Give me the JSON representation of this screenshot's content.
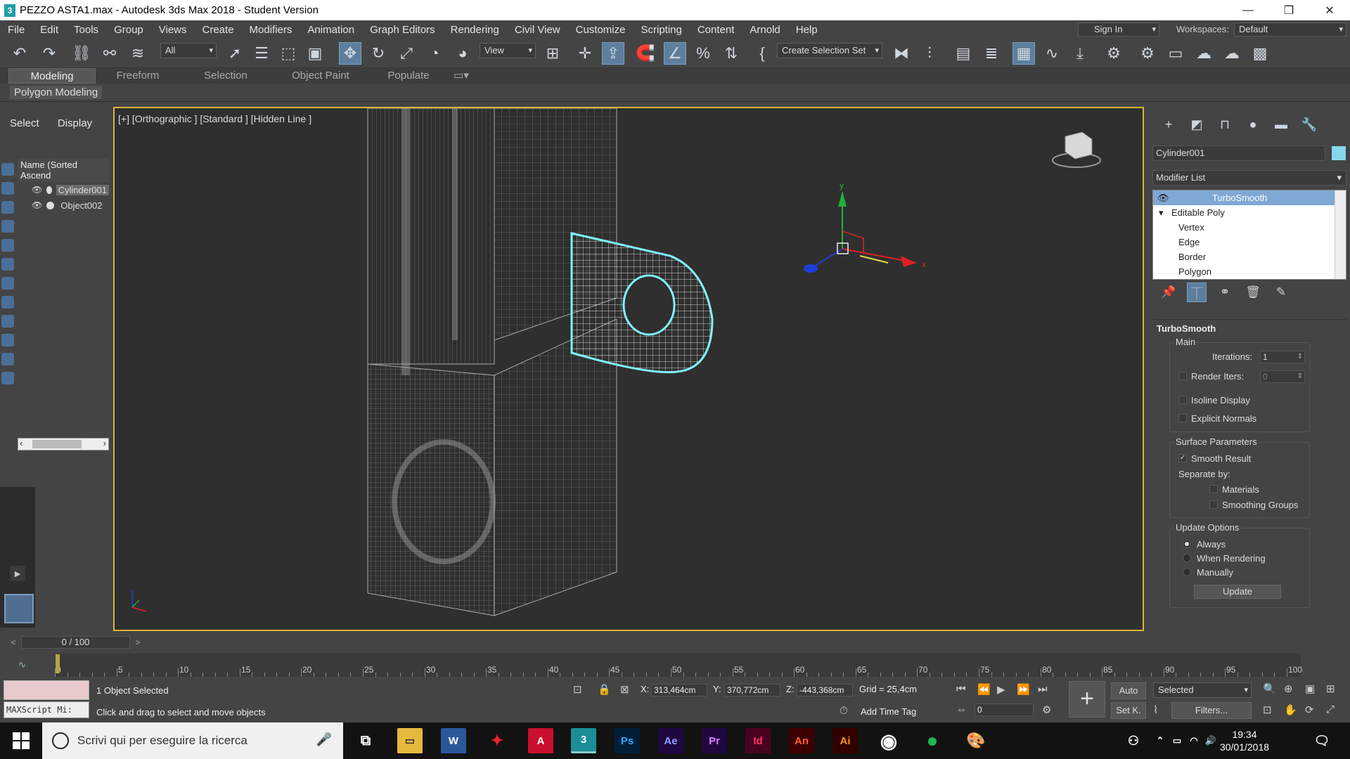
{
  "window": {
    "title": "PEZZO ASTA1.max - Autodesk 3ds Max 2018 - Student Version",
    "icon_label": "3",
    "controls": [
      "—",
      "❐",
      "✕"
    ]
  },
  "menubar": {
    "items": [
      "File",
      "Edit",
      "Tools",
      "Group",
      "Views",
      "Create",
      "Modifiers",
      "Animation",
      "Graph Editors",
      "Rendering",
      "Civil View",
      "Customize",
      "Scripting",
      "Content",
      "Arnold",
      "Help"
    ],
    "sign_in": "Sign In",
    "workspaces_label": "Workspaces:",
    "workspace_value": "Default"
  },
  "toolbar": {
    "selection_filter": "All",
    "ref_coord": "View",
    "create_selection_set": "Create Selection Set"
  },
  "ribbon": {
    "tabs": [
      "Modeling",
      "Freeform",
      "Selection",
      "Object Paint",
      "Populate"
    ],
    "sub": "Polygon Modeling"
  },
  "scene_explorer": {
    "tabs": [
      "Select",
      "Display"
    ],
    "header": "Name (Sorted Ascend",
    "objects": [
      "Cylinder001",
      "Object002"
    ]
  },
  "viewport": {
    "label": "[+] [Orthographic ] [Standard ] [Hidden Line ]",
    "axis_x": "x",
    "axis_y": "y"
  },
  "command_panel": {
    "object_name": "Cylinder001",
    "object_color": "#85d7f0",
    "modifier_list": "Modifier List",
    "stack": [
      "TurboSmooth",
      "Editable Poly",
      "Vertex",
      "Edge",
      "Border",
      "Polygon"
    ],
    "rollout_title": "TurboSmooth",
    "main_group": "Main",
    "iterations_label": "Iterations:",
    "iterations_value": "1",
    "render_iters_label": "Render Iters:",
    "render_iters_value": "0",
    "isoline": "Isoline Display",
    "explicit_normals": "Explicit Normals",
    "surface_group": "Surface Parameters",
    "smooth_result": "Smooth Result",
    "separate_by": "Separate by:",
    "materials": "Materials",
    "smoothing_groups": "Smoothing Groups",
    "update_group": "Update Options",
    "always": "Always",
    "when_rendering": "When Rendering",
    "manually": "Manually",
    "update_btn": "Update"
  },
  "timeline": {
    "frame": "0 / 100",
    "ticks": [
      "0",
      "5",
      "10",
      "15",
      "20",
      "25",
      "30",
      "35",
      "40",
      "45",
      "50",
      "55",
      "60",
      "65",
      "70",
      "75",
      "80",
      "85",
      "90",
      "95",
      "100"
    ]
  },
  "status": {
    "selected": "1 Object Selected",
    "prompt": "Click and drag to select and move objects",
    "maxscript": "MAXScript Mi:",
    "x_label": "X:",
    "x_value": "313,464cm",
    "y_label": "Y:",
    "y_value": "370,772cm",
    "z_label": "Z:",
    "z_value": "-443,368cm",
    "grid": "Grid = 25,4cm",
    "add_time_tag": "Add Time Tag",
    "auto": "Auto",
    "selected_dd": "Selected",
    "setk": "Set K.",
    "filters": "Filters...",
    "frame_field": "0"
  },
  "taskbar": {
    "search": "Scrivi qui per eseguire la ricerca",
    "time": "19:34",
    "date": "30/01/2018",
    "apps": [
      "W",
      "A",
      "3",
      "Ps",
      "Ae",
      "Pr",
      "Id",
      "An",
      "Ai"
    ]
  }
}
